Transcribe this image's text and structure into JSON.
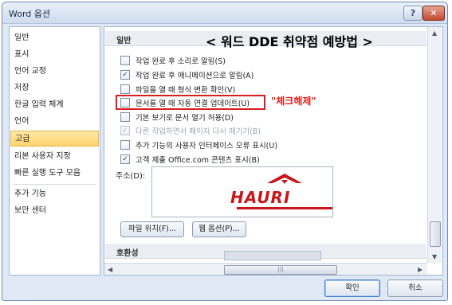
{
  "window": {
    "title": "Word 옵션",
    "help": "?",
    "close": "✕"
  },
  "sidebar": {
    "items": [
      {
        "label": "일반"
      },
      {
        "label": "표시"
      },
      {
        "label": "언어 교정"
      },
      {
        "label": "저장"
      },
      {
        "label": "한글 입력 체계"
      },
      {
        "label": "언어"
      },
      {
        "label": "고급",
        "active": true
      },
      {
        "label": "리본 사용자 지정"
      },
      {
        "label": "빠른 실행 도구 모음"
      },
      {
        "label": "추가 기능"
      },
      {
        "label": "보안 센터"
      }
    ]
  },
  "content": {
    "section_general": "일반",
    "section_compat": "호환성",
    "options": [
      {
        "label": "작업 완료 후 소리로 알림(S)",
        "checked": false,
        "disabled": false
      },
      {
        "label": "작업 완료 후 애니메이션으로 알림(A)",
        "checked": true,
        "disabled": false
      },
      {
        "label": "파일을 열 때 형식 변환 확인(V)",
        "checked": false,
        "disabled": false
      },
      {
        "label": "문서를 열 때 자동 연결 업데이트(U)",
        "checked": false,
        "disabled": false
      },
      {
        "label": "기본 보기로 문서 열기 허용(D)",
        "checked": false,
        "disabled": false
      },
      {
        "label": "다른 작업하면서 페이지 다시 매기기(B)",
        "checked": true,
        "disabled": true
      },
      {
        "label": "추가 기능의 사용자 인터페이스 오류 표시(U)",
        "checked": false,
        "disabled": false
      },
      {
        "label": "고객 제출 Office.com 콘텐츠 표시(B)",
        "checked": true,
        "disabled": false
      }
    ],
    "address_label": "주소(D):",
    "logo_text": "HAURI",
    "file_locations": "파일 위치(F)...",
    "web_options": "웹 옵션(P)..."
  },
  "annotation": {
    "title": "< 워드 DDE 취약점 예방법 >",
    "note": "\"체크해제\"",
    "color": "#e0201e"
  },
  "footer": {
    "ok": "확인",
    "cancel": "취소"
  },
  "icons": [
    "help-icon",
    "close-icon",
    "checkmark-icon",
    "scroll-up-icon",
    "scroll-down-icon",
    "scroll-left-icon",
    "scroll-right-icon",
    "hauri-logo"
  ]
}
